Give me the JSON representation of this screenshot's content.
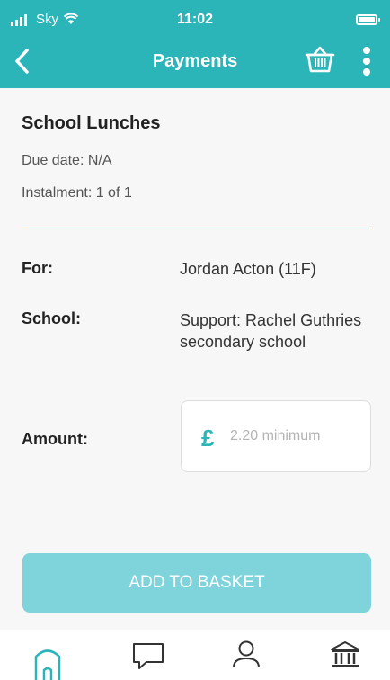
{
  "status_bar": {
    "carrier": "Sky",
    "time": "11:02"
  },
  "header": {
    "title": "Payments",
    "back_icon": "chevron-left-icon",
    "basket_icon": "basket-icon",
    "more_icon": "more-vertical-icon"
  },
  "payment": {
    "title": "School Lunches",
    "due_date": "Due date: N/A",
    "instalment": "Instalment: 1 of 1",
    "rows": {
      "for_label": "For:",
      "for_value": "Jordan Acton (11F)",
      "school_label": "School:",
      "school_value": "Support: Rachel Guthries secondary school",
      "amount_label": "Amount:"
    },
    "amount": {
      "currency": "£",
      "value": "",
      "placeholder": "2.20 minimum"
    },
    "add_button": "ADD TO BASKET"
  },
  "tabbar": {
    "tabs": [
      {
        "icon": "home-icon"
      },
      {
        "icon": "chat-icon"
      },
      {
        "icon": "profile-icon"
      },
      {
        "icon": "bank-icon"
      }
    ]
  },
  "colors": {
    "brand": "#2bb5b8",
    "button_disabled": "#7fd4dc",
    "divider": "#5aa7c8",
    "background": "#f7f7f7"
  }
}
